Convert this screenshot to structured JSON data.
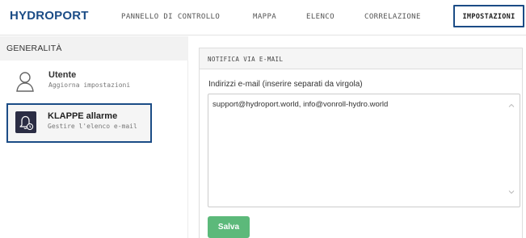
{
  "header": {
    "logo": "HYDROPORT",
    "nav": [
      {
        "label": "PANNELLO DI CONTROLLO"
      },
      {
        "label": "MAPPA"
      },
      {
        "label": "ELENCO"
      },
      {
        "label": "CORRELAZIONE"
      },
      {
        "label": "IMPOSTAZIONI",
        "active": true
      }
    ]
  },
  "sidebar": {
    "heading": "GENERALITÀ",
    "items": [
      {
        "title": "Utente",
        "subtitle": "Aggiorna impostazioni",
        "icon": "user-icon"
      },
      {
        "title": "KLAPPE allarme",
        "subtitle": "Gestire l'elenco e-mail",
        "icon": "bell-clock-icon",
        "selected": true
      }
    ]
  },
  "panel": {
    "heading": "NOTIFICA VIA E-MAIL",
    "field_label": "Indirizzi e-mail (inserire separati da virgola)",
    "field_value": "support@hydroport.world, info@vonroll-hydro.world",
    "save_label": "Salva"
  },
  "colors": {
    "brand": "#1b4c86",
    "save_button": "#5cb97a",
    "alarm_icon_bg": "#2b2d44"
  }
}
